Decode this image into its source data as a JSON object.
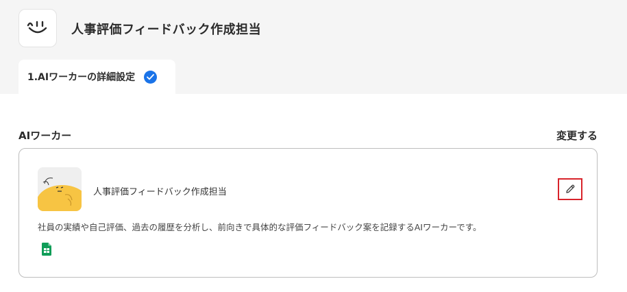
{
  "app": {
    "title": "人事評価フィードバック作成担当",
    "logo_icon": "smile-face-icon"
  },
  "steps": [
    {
      "label": "1.AIワーカーの詳細設定",
      "completed": true,
      "status_icon": "check-circle-icon"
    }
  ],
  "section": {
    "title": "AIワーカー",
    "change_label": "変更する"
  },
  "worker": {
    "name": "人事評価フィードバック作成担当",
    "description": "社員の実績や自己評価、過去の履歴を分析し、前向きで具体的な評価フィードバック案を記録するAIワーカーです。",
    "avatar_icon": "yellow-character-avatar",
    "edit_icon": "pencil-icon",
    "tool_icon": "google-sheets-icon"
  },
  "colors": {
    "accent": "#1a73e8",
    "highlight_border": "#d8232a",
    "header_bg": "#f5f5f5",
    "sheets_green": "#0f9d58",
    "avatar_yellow": "#f7c443"
  }
}
